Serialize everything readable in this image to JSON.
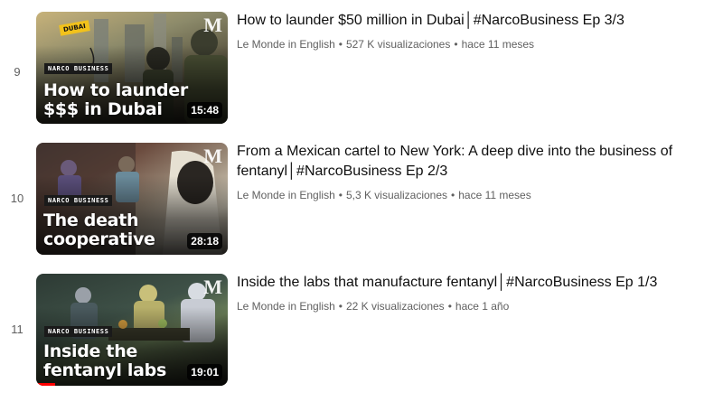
{
  "videos": [
    {
      "index": "9",
      "title": "How to launder $50 million in Dubai│#NarcoBusiness Ep 3/3",
      "channel": "Le Monde in English",
      "views": "527 K visualizaciones",
      "age": "hace 11 meses",
      "duration": "15:48",
      "thumbnail": {
        "series_tag": "NARCO BUSINESS",
        "title": "How to launder $$$ in Dubai",
        "location_tag": "DUBAI",
        "logo": "M"
      }
    },
    {
      "index": "10",
      "title": "From a Mexican cartel to New York: A deep dive into the business of fentanyl│#NarcoBusiness Ep 2/3",
      "channel": "Le Monde in English",
      "views": "5,3 K visualizaciones",
      "age": "hace 11 meses",
      "duration": "28:18",
      "thumbnail": {
        "series_tag": "NARCO BUSINESS",
        "title": "The death cooperative",
        "logo": "M"
      }
    },
    {
      "index": "11",
      "title": "Inside the labs that manufacture fentanyl│#NarcoBusiness Ep 1/3",
      "channel": "Le Monde in English",
      "views": "22 K visualizaciones",
      "age": "hace 1 año",
      "duration": "19:01",
      "watch_progress": 0.1,
      "thumbnail": {
        "series_tag": "NARCO BUSINESS",
        "title": "Inside the fentanyl labs",
        "logo": "M"
      }
    }
  ],
  "separator": "•",
  "colors": {
    "progress": "#ff0000",
    "title_text": "#0f0f0f",
    "meta_text": "#606060",
    "location_tag": "#f2c21b"
  }
}
